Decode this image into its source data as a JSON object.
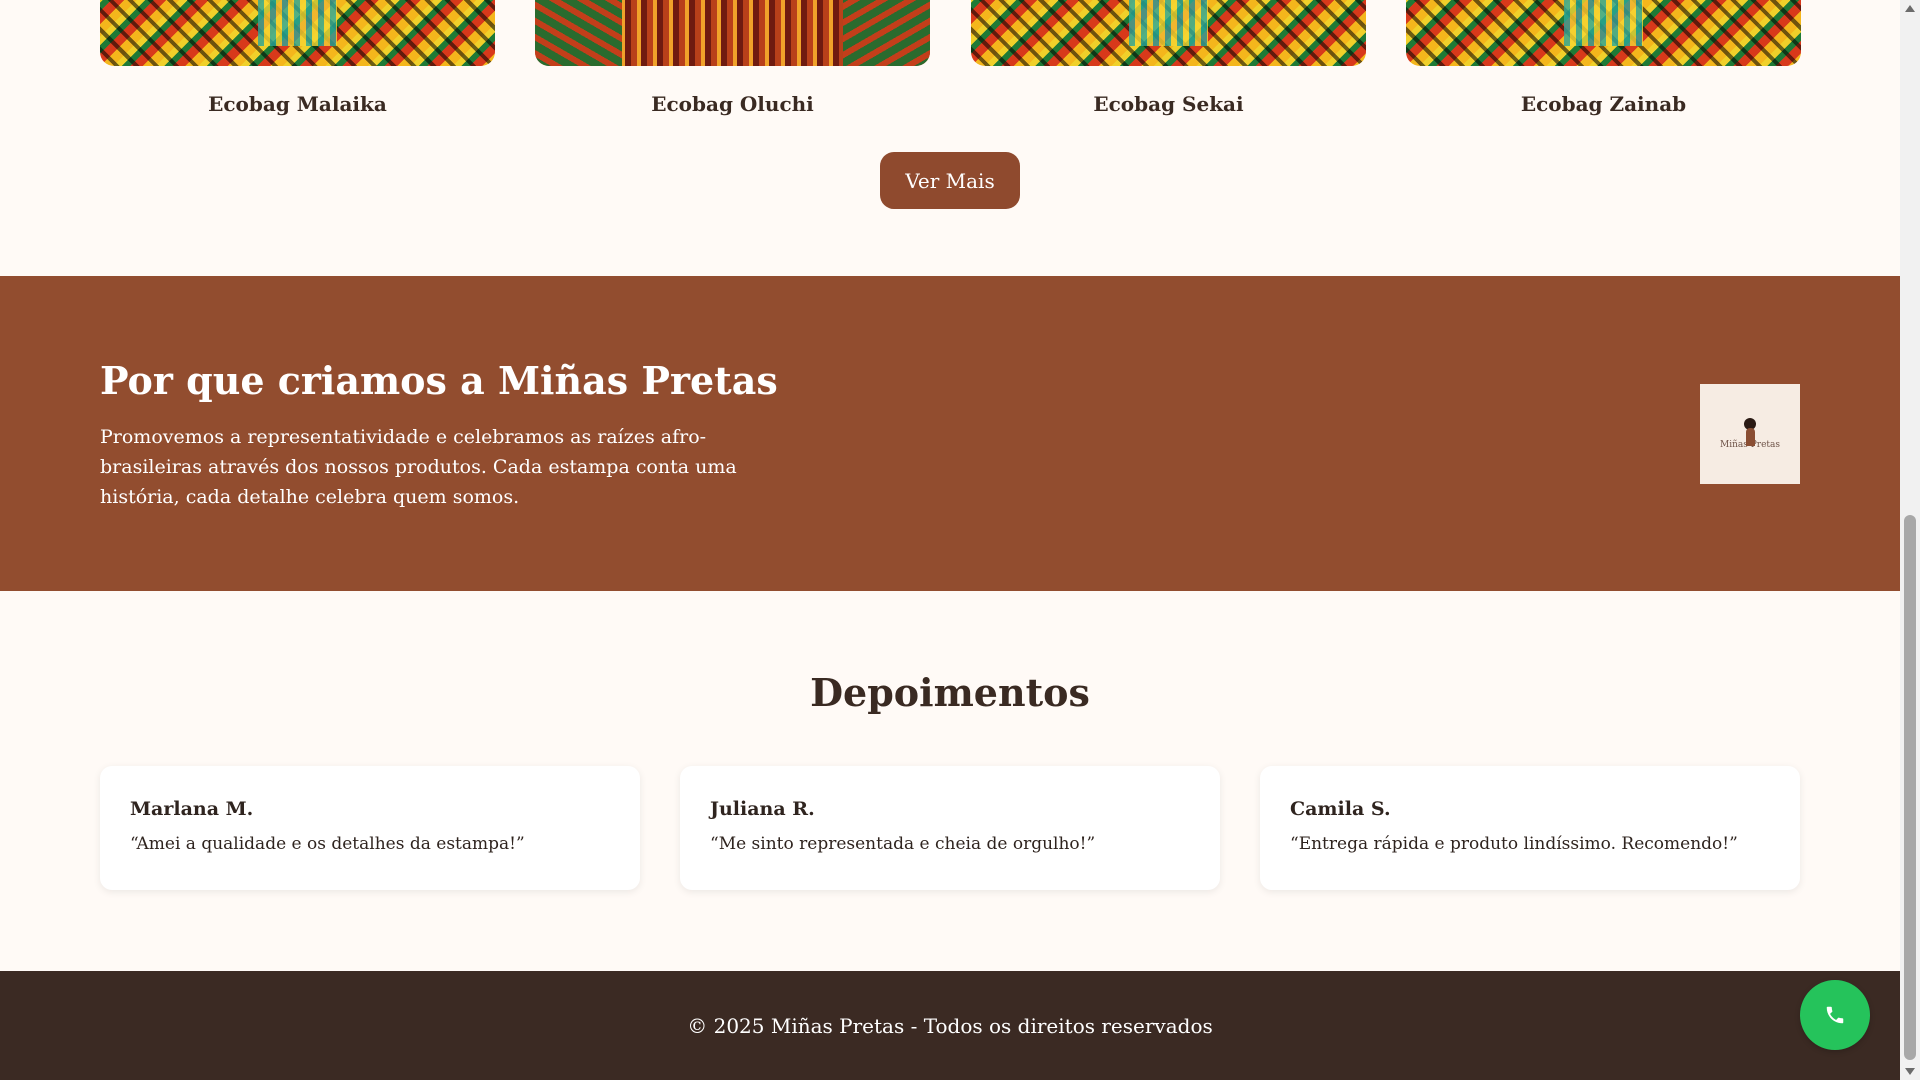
{
  "products": [
    {
      "name": "Ecobag Malaika",
      "pattern": "kente-geometric"
    },
    {
      "name": "Ecobag Oluchi",
      "pattern": "striped-red"
    },
    {
      "name": "Ecobag Sekai",
      "pattern": "kente-geometric"
    },
    {
      "name": "Ecobag Zainab",
      "pattern": "kente-geometric"
    }
  ],
  "more_button_label": "Ver Mais",
  "about": {
    "title": "Por que criamos a Miñas Pretas",
    "text": "Promovemos a representatividade e celebramos as raízes afro-brasileiras através dos nossos produtos. Cada estampa conta uma história, cada detalhe celebra quem somos.",
    "logo_text": "Miñas Pretas"
  },
  "testimonials": {
    "title": "Depoimentos",
    "items": [
      {
        "name": "Marlana M.",
        "text": "“Amei a qualidade e os detalhes da estampa!”"
      },
      {
        "name": "Juliana R.",
        "text": "“Me sinto representada e cheia de orgulho!”"
      },
      {
        "name": "Camila S.",
        "text": "“Entrega rápida e produto lindíssimo. Recomendo!”"
      }
    ]
  },
  "footer_text": "© 2025 Miñas Pretas - Todos os direitos reservados",
  "icons": {
    "whatsapp": "phone-icon"
  },
  "colors": {
    "accent": "#924d2f",
    "button": "#8f4a2e",
    "footer": "#3b2a23",
    "whatsapp": "#25c35b",
    "background": "#fffaf6"
  }
}
